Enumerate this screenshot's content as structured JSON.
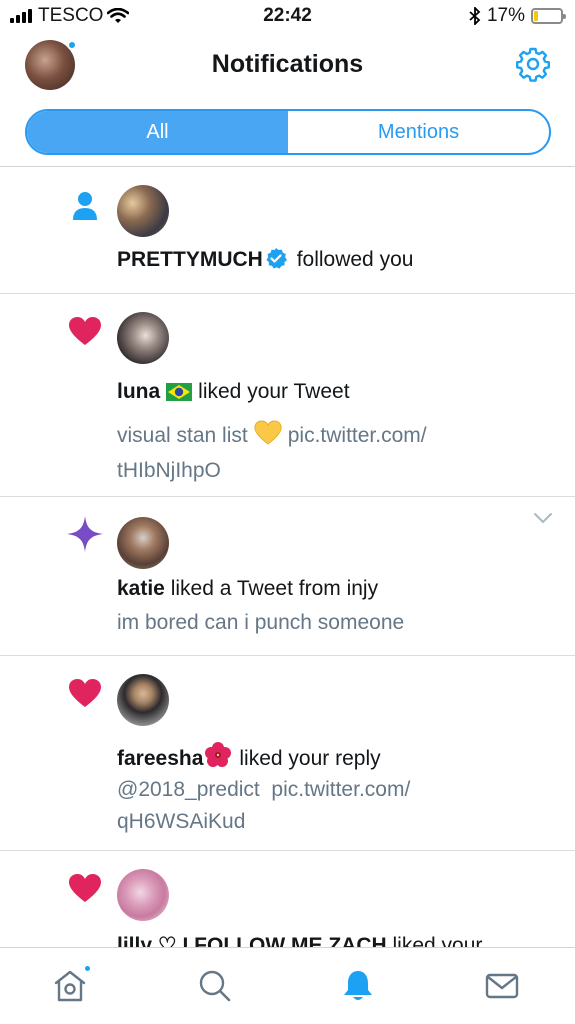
{
  "status_bar": {
    "carrier": "TESCO",
    "time": "22:42",
    "battery": "17%",
    "battery_level": 0.17
  },
  "header": {
    "title": "Notifications",
    "profile_has_unread": true
  },
  "tabs": [
    {
      "label": "All",
      "selected": true
    },
    {
      "label": "Mentions",
      "selected": false
    }
  ],
  "notifications": [
    {
      "kind": "follow",
      "user": "PRETTYMUCH",
      "verified": true,
      "action": "followed you"
    },
    {
      "kind": "like",
      "user": "luna",
      "flag": "🇧🇷",
      "action": "liked your Tweet",
      "text1": "visual stan list",
      "emoji": "💛",
      "link1": "pic.twitter.com/",
      "link2": "tHIbNjIhpO"
    },
    {
      "kind": "recommendation",
      "user": "katie",
      "action": "liked a Tweet from injy",
      "text": "im bored can i punch someone"
    },
    {
      "kind": "like",
      "user": "fareesha",
      "flower": "🌺",
      "action": "liked your reply",
      "mention": "@2018_predict",
      "link1": "pic.twitter.com/",
      "link2": "qH6WSAiKud"
    },
    {
      "kind": "like",
      "user": "lilly ♡ I FOLLOW ME ZACH",
      "action": "liked your"
    }
  ],
  "tab_bar": {
    "items": [
      "home-icon",
      "search-icon",
      "notifications-icon",
      "messages-icon"
    ],
    "selected": "notifications-icon"
  },
  "colors": {
    "accent": "#1da1f2",
    "like": "#e0245e",
    "sparkle": "#794bc4",
    "secondary_text": "#657786"
  }
}
